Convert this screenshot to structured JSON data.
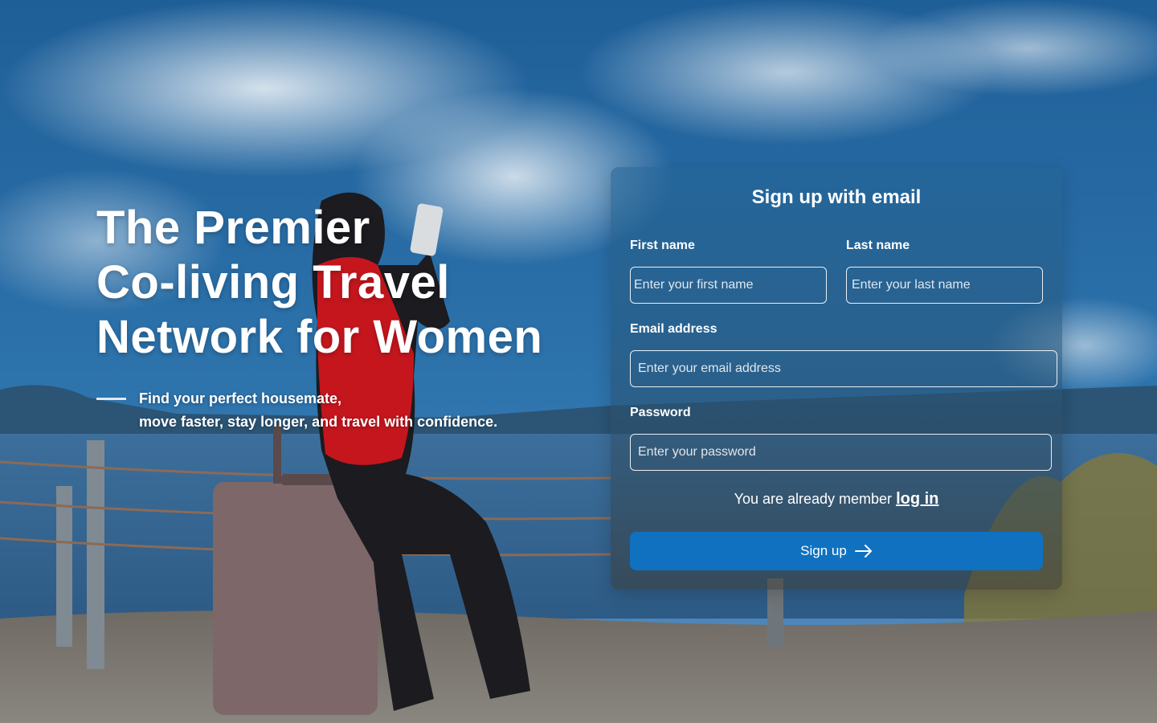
{
  "hero": {
    "title_lines": [
      "The Premier",
      "Co-living Travel",
      "Network for Women"
    ],
    "subtitle_lines": [
      "Find your perfect housemate,",
      "move faster, stay longer, and travel with confidence."
    ]
  },
  "signup": {
    "title": "Sign up with email",
    "first_name": {
      "label": "First name",
      "placeholder": "Enter your first name"
    },
    "last_name": {
      "label": "Last name",
      "placeholder": "Enter your last name"
    },
    "email": {
      "label": "Email address",
      "placeholder": "Enter your email address"
    },
    "password": {
      "label": "Password",
      "placeholder": "Enter your password"
    },
    "member_text": "You are already member",
    "login_label": "log in",
    "button_label": "Sign up",
    "button_icon": "arrow-right-icon"
  },
  "colors": {
    "button": "#0f71c0",
    "text": "#ffffff"
  }
}
